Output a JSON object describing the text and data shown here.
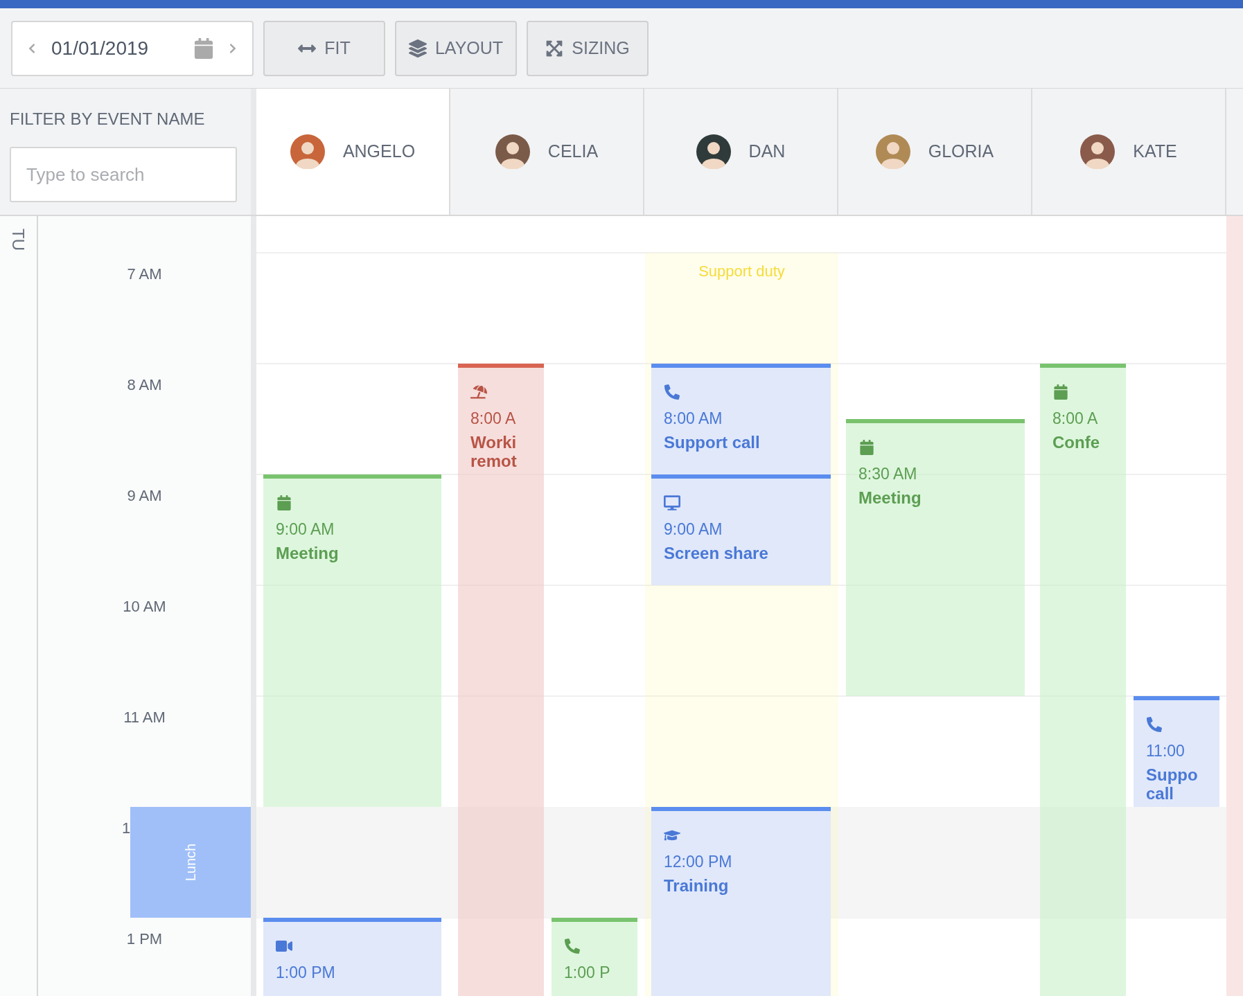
{
  "toolbar": {
    "date": "01/01/2019",
    "buttons": [
      {
        "kind": "fit",
        "label": "FIT"
      },
      {
        "kind": "layout",
        "label": "LAYOUT"
      },
      {
        "kind": "sizing",
        "label": "SIZING"
      }
    ]
  },
  "filter": {
    "label": "FILTER BY EVENT NAME",
    "placeholder": "Type to search"
  },
  "resources": [
    {
      "name": "ANGELO",
      "selected": true,
      "color": "#c8653a",
      "events": [
        {
          "kind": "meeting",
          "color": "#79c36e",
          "time": "9:00 AM",
          "title": "Meeting"
        },
        {
          "kind": "video",
          "color": "#5b8def",
          "time": "1:00 PM"
        }
      ]
    },
    {
      "name": "CELIA",
      "selected": false,
      "color": "#7a5a48",
      "events": [
        {
          "kind": "vacation",
          "color": "#d86452",
          "time": "8:00 A",
          "title": "Worki\nremot"
        },
        {
          "kind": "call",
          "color": "#79c36e",
          "time": "1:00 P"
        }
      ]
    },
    {
      "name": "DAN",
      "selected": false,
      "color": "#2f3b3a",
      "band": {
        "label": "Support duty"
      },
      "events": [
        {
          "kind": "call",
          "color": "#5b8def",
          "time": "8:00 AM",
          "title": "Support call"
        },
        {
          "kind": "screen",
          "color": "#5b8def",
          "time": "9:00 AM",
          "title": "Screen share"
        },
        {
          "kind": "training",
          "color": "#5b8def",
          "time": "12:00 PM",
          "title": "Training"
        }
      ]
    },
    {
      "name": "GLORIA",
      "selected": false,
      "color": "#b08a55",
      "events": [
        {
          "kind": "meeting",
          "color": "#79c36e",
          "time": "8:30 AM",
          "title": "Meeting"
        }
      ]
    },
    {
      "name": "KATE",
      "selected": false,
      "color": "#8a5a4a",
      "events": [
        {
          "kind": "meeting",
          "color": "#79c36e",
          "time": "8:00 A",
          "title": "Confe"
        },
        {
          "kind": "call",
          "color": "#5b8def",
          "time": "11:00",
          "title": "Suppo\ncall"
        }
      ]
    }
  ],
  "edge_event": {
    "color": "#f9e6e4"
  },
  "time_column": {
    "day_label": "TU",
    "slots": [
      {
        "label": "7 AM"
      },
      {
        "label": "8 AM"
      },
      {
        "label": "9 AM"
      },
      {
        "label": "10 AM"
      },
      {
        "label": "11 AM"
      },
      {
        "label": "1",
        "break": "Lunch"
      },
      {
        "label": "1 PM"
      }
    ]
  }
}
